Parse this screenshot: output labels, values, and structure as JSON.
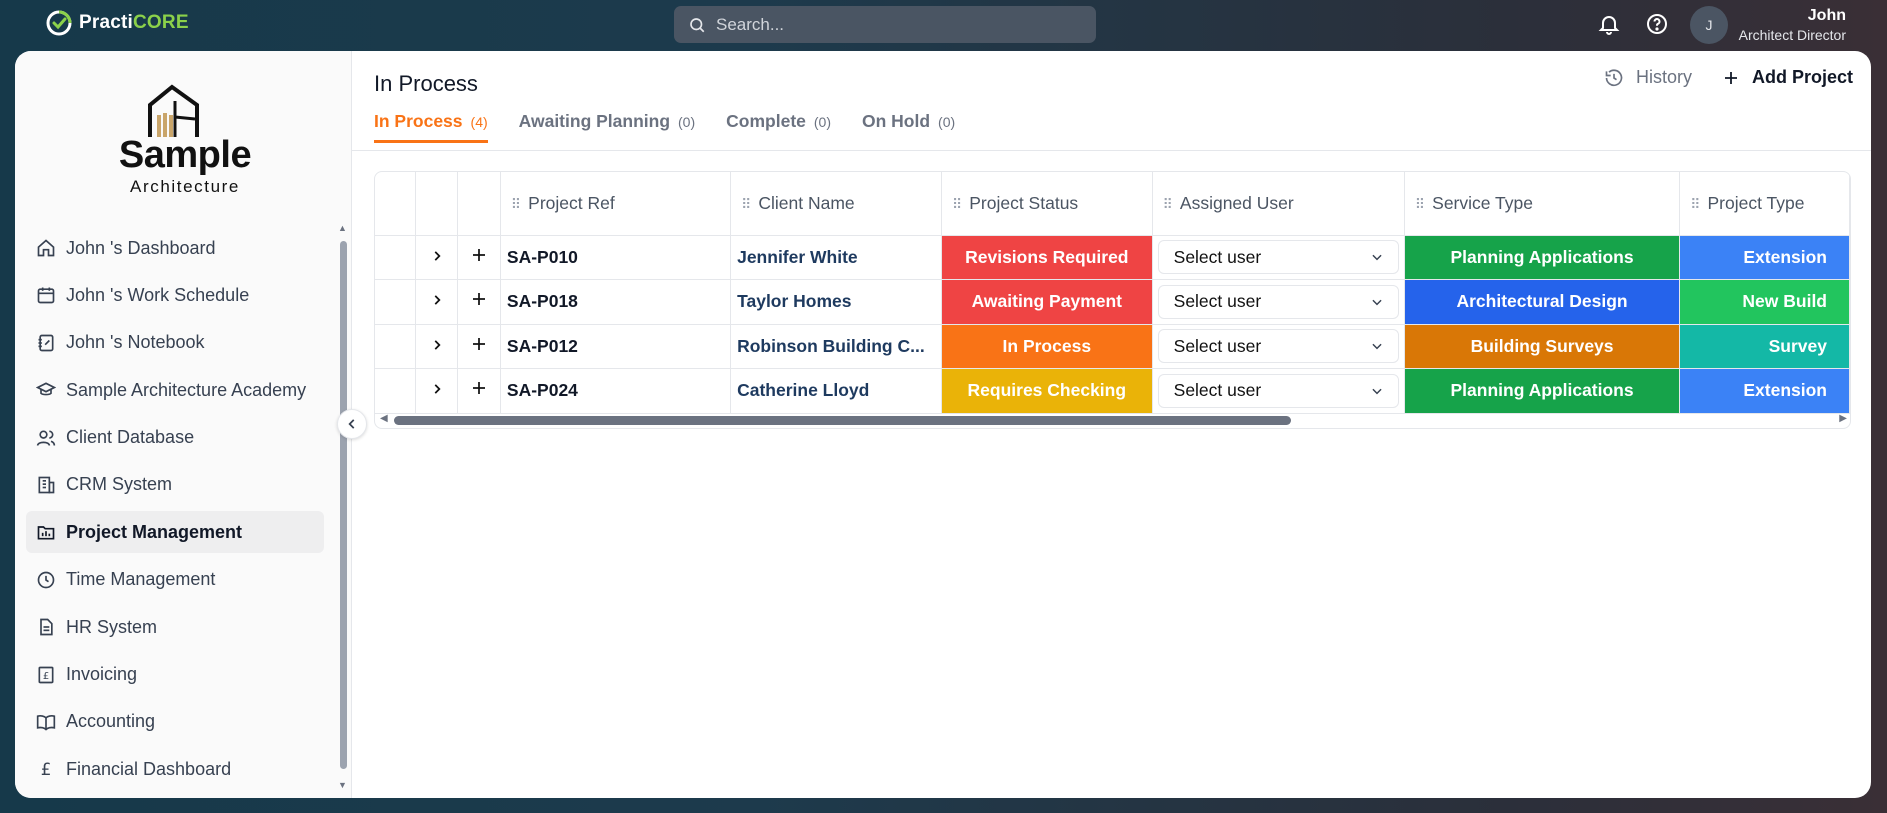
{
  "app": {
    "brand_prefix": "Practi",
    "brand_suffix": "CORE"
  },
  "search": {
    "placeholder": "Search..."
  },
  "user": {
    "name": "John",
    "role": "Architect Director",
    "initial": "J"
  },
  "company": {
    "name": "Sample",
    "subtitle": "Architecture"
  },
  "sidebar": {
    "items": [
      {
        "label": "John 's Dashboard",
        "icon": "home-icon",
        "active": false
      },
      {
        "label": "John 's Work Schedule",
        "icon": "calendar-icon",
        "active": false
      },
      {
        "label": "John 's Notebook",
        "icon": "notebook-icon",
        "active": false
      },
      {
        "label": "Sample Architecture Academy",
        "icon": "graduation-cap-icon",
        "active": false
      },
      {
        "label": "Client Database",
        "icon": "users-icon",
        "active": false
      },
      {
        "label": "CRM System",
        "icon": "building-icon",
        "active": false
      },
      {
        "label": "Project Management",
        "icon": "folder-chart-icon",
        "active": true
      },
      {
        "label": "Time Management",
        "icon": "clock-icon",
        "active": false
      },
      {
        "label": "HR System",
        "icon": "document-icon",
        "active": false
      },
      {
        "label": "Invoicing",
        "icon": "pound-receipt-icon",
        "active": false
      },
      {
        "label": "Accounting",
        "icon": "book-open-icon",
        "active": false
      },
      {
        "label": "Financial Dashboard",
        "icon": "pound-icon",
        "active": false
      }
    ]
  },
  "page": {
    "title": "In Process",
    "history_label": "History",
    "add_label": "Add Project",
    "tabs": [
      {
        "label": "In Process",
        "count": "(4)",
        "active": true
      },
      {
        "label": "Awaiting Planning",
        "count": "(0)",
        "active": false
      },
      {
        "label": "Complete",
        "count": "(0)",
        "active": false
      },
      {
        "label": "On Hold",
        "count": "(0)",
        "active": false
      }
    ]
  },
  "table": {
    "columns": [
      "Project Ref",
      "Client Name",
      "Project Status",
      "Assigned User",
      "Service Type",
      "Project Type"
    ],
    "rows": [
      {
        "ref": "SA-P010",
        "client": "Jennifer White",
        "status": "Revisions Required",
        "status_color": "#ef4444",
        "user": "Select user",
        "service": "Planning Applications",
        "service_color": "#16a34a",
        "type": "Extension",
        "type_color": "#3b82f6"
      },
      {
        "ref": "SA-P018",
        "client": "Taylor Homes",
        "status": "Awaiting Payment",
        "status_color": "#ef4444",
        "user": "Select user",
        "service": "Architectural Design",
        "service_color": "#2563eb",
        "type": "New Build",
        "type_color": "#22c55e"
      },
      {
        "ref": "SA-P012",
        "client": "Robinson Building C...",
        "status": "In Process",
        "status_color": "#f97316",
        "user": "Select user",
        "service": "Building Surveys",
        "service_color": "#d97706",
        "type": "Survey",
        "type_color": "#14b8a6"
      },
      {
        "ref": "SA-P024",
        "client": "Catherine Lloyd",
        "status": "Requires Checking",
        "status_color": "#eab308",
        "user": "Select user",
        "service": "Planning Applications",
        "service_color": "#16a34a",
        "type": "Extension",
        "type_color": "#3b82f6"
      }
    ]
  },
  "colors": {
    "accent": "#f97316",
    "brand_green": "#8bd14a"
  }
}
